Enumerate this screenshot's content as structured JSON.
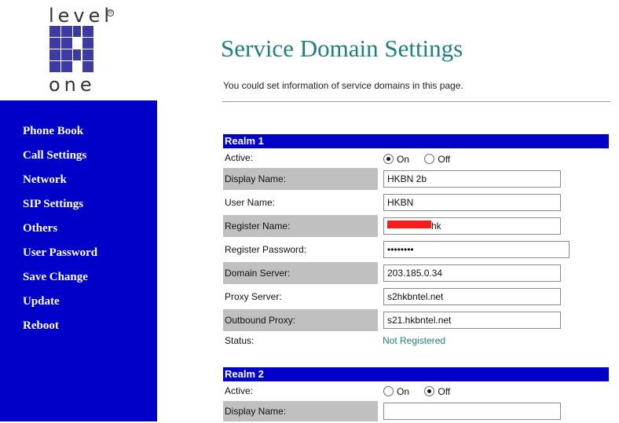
{
  "brand": {
    "logo_text_top": "level",
    "logo_text_bottom": "one",
    "logo_mark": "®",
    "accent": "#0000c8",
    "title_color": "#1f7f7f"
  },
  "sidebar": {
    "items": [
      {
        "label": "Phone Book"
      },
      {
        "label": "Call Settings"
      },
      {
        "label": "Network"
      },
      {
        "label": "SIP Settings"
      },
      {
        "label": "Others"
      },
      {
        "label": "User Password"
      },
      {
        "label": "Save Change"
      },
      {
        "label": "Update"
      },
      {
        "label": "Reboot"
      }
    ]
  },
  "page": {
    "title": "Service Domain Settings",
    "description": "You could set information of service domains in this page."
  },
  "realm1": {
    "header": "Realm 1",
    "active_label": "Active:",
    "on_label": "On",
    "off_label": "Off",
    "active": "On",
    "display_name_label": "Display Name:",
    "display_name": "HKBN 2b",
    "user_name_label": "User Name:",
    "user_name": "HKBN",
    "register_name_label": "Register Name:",
    "register_name_visible": "hk",
    "register_password_label": "Register Password:",
    "register_password": "••••••••",
    "domain_server_label": "Domain Server:",
    "domain_server": "203.185.0.34",
    "proxy_server_label": "Proxy Server:",
    "proxy_server": "s2hkbntel.net",
    "outbound_proxy_label": "Outbound Proxy:",
    "outbound_proxy": "s21.hkbntel.net",
    "status_label": "Status:",
    "status": "Not Registered"
  },
  "realm2": {
    "header": "Realm 2",
    "active_label": "Active:",
    "on_label": "On",
    "off_label": "Off",
    "active": "Off",
    "display_name_label": "Display Name:",
    "display_name": ""
  }
}
